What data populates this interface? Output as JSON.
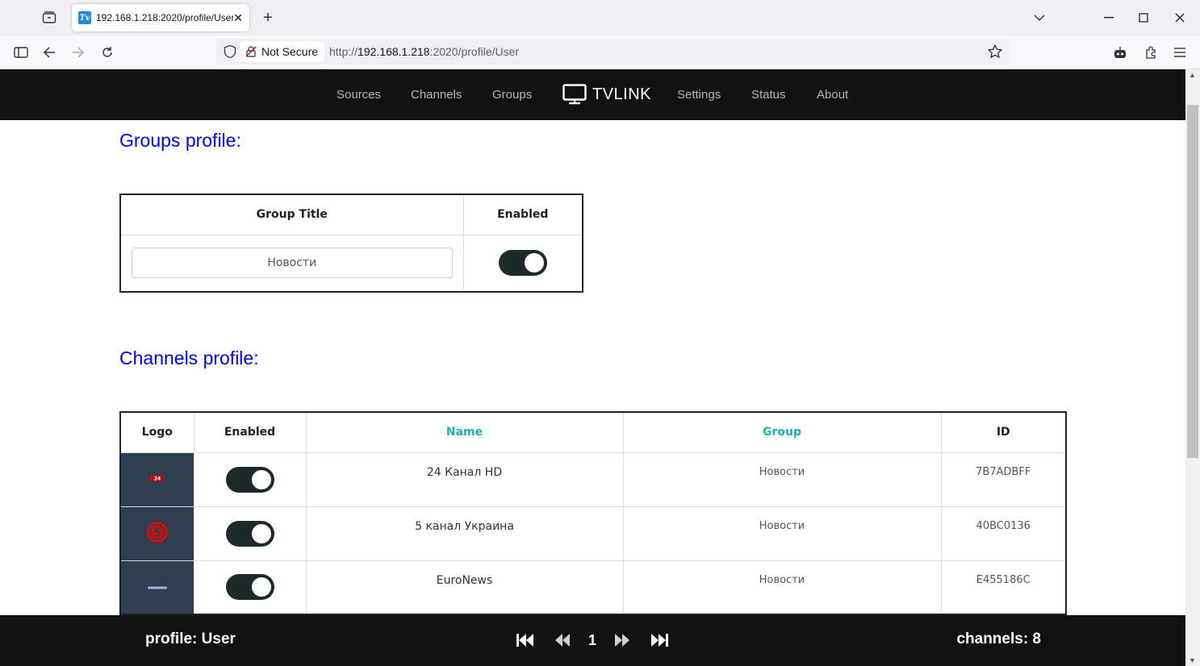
{
  "browser": {
    "tab_title": "192.168.1.218:2020/profile/User",
    "tab_close": "✕",
    "new_tab": "+",
    "not_secure": "Not Secure",
    "url_prefix": "http://",
    "url_host": "192.168.1.218",
    "url_rest": ":2020/profile/User"
  },
  "app": {
    "nav": {
      "sources": "Sources",
      "channels": "Channels",
      "groups": "Groups",
      "brand": "TVLINK",
      "settings": "Settings",
      "status": "Status",
      "about": "About"
    },
    "groups_profile_title": "Groups profile:",
    "channels_profile_title": "Channels profile:",
    "groups_table": {
      "headers": {
        "title": "Group Title",
        "enabled": "Enabled"
      },
      "rows": [
        {
          "title": "Новости",
          "enabled": true
        }
      ]
    },
    "channels_table": {
      "headers": {
        "logo": "Logo",
        "enabled": "Enabled",
        "name": "Name",
        "group": "Group",
        "id": "ID"
      },
      "rows": [
        {
          "logo": "24-kanal-logo",
          "enabled": true,
          "name": "24 Канал HD",
          "group": "Новости",
          "id": "7B7ADBFF"
        },
        {
          "logo": "5-kanal-logo",
          "enabled": true,
          "name": "5 канал Украина",
          "group": "Новости",
          "id": "40BC0136"
        },
        {
          "logo": "euronews-logo",
          "enabled": true,
          "name": "EuroNews",
          "group": "Новости",
          "id": "E455186C"
        }
      ]
    },
    "footer": {
      "profile": "profile: User",
      "page": "1",
      "channels_count": "channels: 8"
    }
  },
  "colors": {
    "header_bg": "#121212",
    "section_title": "#0000ee",
    "sort_header": "#17b5a4",
    "toggle_on": "#1e2a2a",
    "logo_bg": "#2e3e50"
  }
}
